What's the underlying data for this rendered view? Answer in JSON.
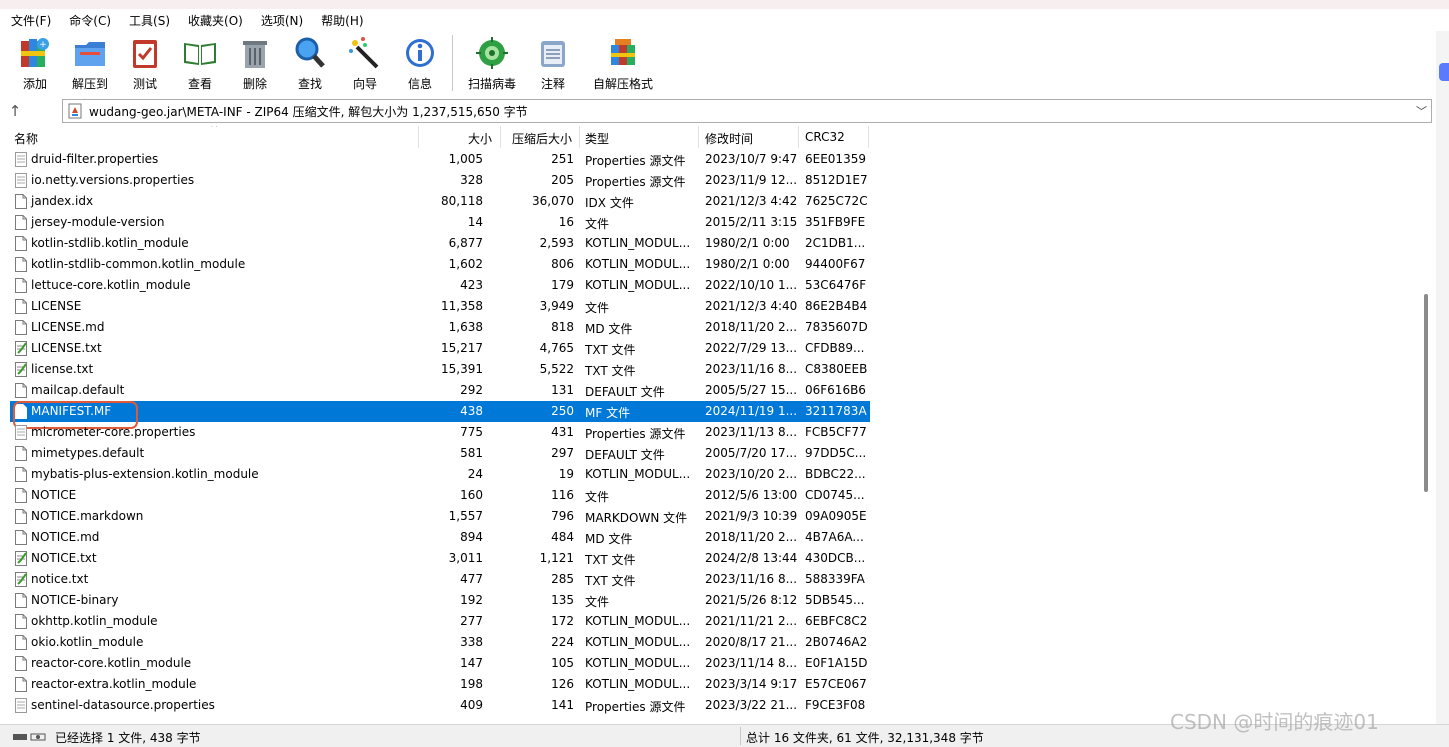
{
  "menu": [
    "文件(F)",
    "命令(C)",
    "工具(S)",
    "收藏夹(O)",
    "选项(N)",
    "帮助(H)"
  ],
  "toolbar": {
    "add": "添加",
    "extract": "解压到",
    "test": "测试",
    "view": "查看",
    "delete": "删除",
    "find": "查找",
    "wizard": "向导",
    "info": "信息",
    "scan": "扫描病毒",
    "comment": "注释",
    "sfx": "自解压格式"
  },
  "address": "wudang-geo.jar\\META-INF - ZIP64 压缩文件, 解包大小为 1,237,515,650 字节",
  "columns": {
    "name": "名称",
    "size": "大小",
    "packed": "压缩后大小",
    "type": "类型",
    "modified": "修改时间",
    "crc": "CRC32"
  },
  "files": [
    {
      "name": "druid-filter.properties",
      "size": "1,005",
      "packed": "251",
      "type": "Properties 源文件",
      "modified": "2023/10/7 9:47",
      "crc": "6EE01359",
      "icon": "doc"
    },
    {
      "name": "io.netty.versions.properties",
      "size": "328",
      "packed": "205",
      "type": "Properties 源文件",
      "modified": "2023/11/9 12...",
      "crc": "8512D1E7",
      "icon": "doc"
    },
    {
      "name": "jandex.idx",
      "size": "80,118",
      "packed": "36,070",
      "type": "IDX 文件",
      "modified": "2021/12/3 4:42",
      "crc": "7625C72C",
      "icon": "blank"
    },
    {
      "name": "jersey-module-version",
      "size": "14",
      "packed": "16",
      "type": "文件",
      "modified": "2015/2/11 3:15",
      "crc": "351FB9FE",
      "icon": "blank"
    },
    {
      "name": "kotlin-stdlib.kotlin_module",
      "size": "6,877",
      "packed": "2,593",
      "type": "KOTLIN_MODUL...",
      "modified": "1980/2/1 0:00",
      "crc": "2C1DB1...",
      "icon": "blank"
    },
    {
      "name": "kotlin-stdlib-common.kotlin_module",
      "size": "1,602",
      "packed": "806",
      "type": "KOTLIN_MODUL...",
      "modified": "1980/2/1 0:00",
      "crc": "94400F67",
      "icon": "blank"
    },
    {
      "name": "lettuce-core.kotlin_module",
      "size": "423",
      "packed": "179",
      "type": "KOTLIN_MODUL...",
      "modified": "2022/10/10 1...",
      "crc": "53C6476F",
      "icon": "blank"
    },
    {
      "name": "LICENSE",
      "size": "11,358",
      "packed": "3,949",
      "type": "文件",
      "modified": "2021/12/3 4:40",
      "crc": "86E2B4B4",
      "icon": "blank"
    },
    {
      "name": "LICENSE.md",
      "size": "1,638",
      "packed": "818",
      "type": "MD 文件",
      "modified": "2018/11/20 2...",
      "crc": "7835607D",
      "icon": "blank"
    },
    {
      "name": "LICENSE.txt",
      "size": "15,217",
      "packed": "4,765",
      "type": "TXT 文件",
      "modified": "2022/7/29 13...",
      "crc": "CFDB89...",
      "icon": "txt"
    },
    {
      "name": "license.txt",
      "size": "15,391",
      "packed": "5,522",
      "type": "TXT 文件",
      "modified": "2023/11/16 8...",
      "crc": "C8380EEB",
      "icon": "txt"
    },
    {
      "name": "mailcap.default",
      "size": "292",
      "packed": "131",
      "type": "DEFAULT 文件",
      "modified": "2005/5/27 15...",
      "crc": "06F616B6",
      "icon": "blank"
    },
    {
      "name": "MANIFEST.MF",
      "size": "438",
      "packed": "250",
      "type": "MF 文件",
      "modified": "2024/11/19 1...",
      "crc": "3211783A",
      "icon": "blank",
      "selected": true
    },
    {
      "name": "micrometer-core.properties",
      "size": "775",
      "packed": "431",
      "type": "Properties 源文件",
      "modified": "2023/11/13 8...",
      "crc": "FCB5CF77",
      "icon": "doc"
    },
    {
      "name": "mimetypes.default",
      "size": "581",
      "packed": "297",
      "type": "DEFAULT 文件",
      "modified": "2005/7/20 17...",
      "crc": "97DD5C...",
      "icon": "blank"
    },
    {
      "name": "mybatis-plus-extension.kotlin_module",
      "size": "24",
      "packed": "19",
      "type": "KOTLIN_MODUL...",
      "modified": "2023/10/20 2...",
      "crc": "BDBC22...",
      "icon": "blank"
    },
    {
      "name": "NOTICE",
      "size": "160",
      "packed": "116",
      "type": "文件",
      "modified": "2012/5/6 13:00",
      "crc": "CD0745...",
      "icon": "blank"
    },
    {
      "name": "NOTICE.markdown",
      "size": "1,557",
      "packed": "796",
      "type": "MARKDOWN 文件",
      "modified": "2021/9/3 10:39",
      "crc": "09A0905E",
      "icon": "blank"
    },
    {
      "name": "NOTICE.md",
      "size": "894",
      "packed": "484",
      "type": "MD 文件",
      "modified": "2018/11/20 2...",
      "crc": "4B7A6A...",
      "icon": "blank"
    },
    {
      "name": "NOTICE.txt",
      "size": "3,011",
      "packed": "1,121",
      "type": "TXT 文件",
      "modified": "2024/2/8 13:44",
      "crc": "430DCB...",
      "icon": "txt"
    },
    {
      "name": "notice.txt",
      "size": "477",
      "packed": "285",
      "type": "TXT 文件",
      "modified": "2023/11/16 8...",
      "crc": "588339FA",
      "icon": "txt"
    },
    {
      "name": "NOTICE-binary",
      "size": "192",
      "packed": "135",
      "type": "文件",
      "modified": "2021/5/26 8:12",
      "crc": "5DB545...",
      "icon": "blank"
    },
    {
      "name": "okhttp.kotlin_module",
      "size": "277",
      "packed": "172",
      "type": "KOTLIN_MODUL...",
      "modified": "2021/11/21 2...",
      "crc": "6EBFC8C2",
      "icon": "blank"
    },
    {
      "name": "okio.kotlin_module",
      "size": "338",
      "packed": "224",
      "type": "KOTLIN_MODUL...",
      "modified": "2020/8/17 21...",
      "crc": "2B0746A2",
      "icon": "blank"
    },
    {
      "name": "reactor-core.kotlin_module",
      "size": "147",
      "packed": "105",
      "type": "KOTLIN_MODUL...",
      "modified": "2023/11/14 8...",
      "crc": "E0F1A15D",
      "icon": "blank"
    },
    {
      "name": "reactor-extra.kotlin_module",
      "size": "198",
      "packed": "126",
      "type": "KOTLIN_MODUL...",
      "modified": "2023/3/14 9:17",
      "crc": "E57CE067",
      "icon": "blank"
    },
    {
      "name": "sentinel-datasource.properties",
      "size": "409",
      "packed": "141",
      "type": "Properties 源文件",
      "modified": "2023/3/22 21...",
      "crc": "F9CE3F08",
      "icon": "doc"
    }
  ],
  "status": {
    "left": "已经选择 1 文件, 438 字节",
    "right": "总计 16 文件夹, 61 文件, 32,131,348 字节"
  },
  "watermark": "CSDN @时间的痕迹01",
  "colors": {
    "selection": "#0078d7",
    "highlight_ring": "#e05a3a"
  }
}
